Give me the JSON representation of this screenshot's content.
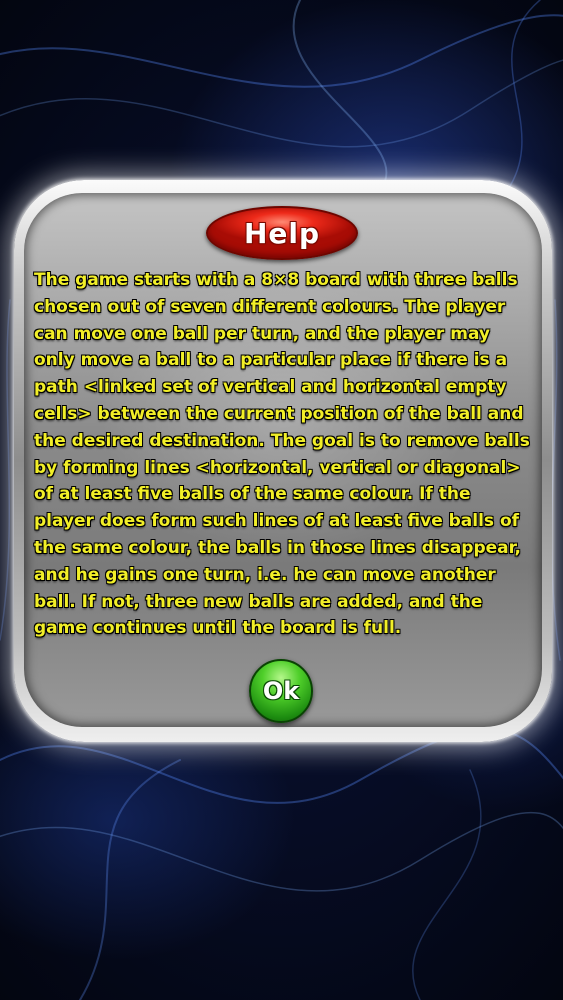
{
  "dialog": {
    "title": "Help",
    "body": "The game starts with a 8×8 board with three balls chosen out of seven different colours. The  player can move one ball per turn, and the player may only move a ball to a particular place if there is a path <linked set of vertical and horizontal empty cells> between the current position of the ball and the desired destination. The goal is to remove balls by forming lines <horizontal, vertical or diagonal> of at least five balls of the same colour. If the player does form such lines of at least five balls of the same colour, the balls in those lines disappear, and he gains one turn, i.e. he can move another ball. If not, three new balls are added, and the game continues until the board is full.",
    "ok_label": "Ok"
  },
  "colors": {
    "text": "#f2ef28",
    "title_button": "#e8261a",
    "ok_button": "#3cc21f",
    "background": "#050a22"
  }
}
